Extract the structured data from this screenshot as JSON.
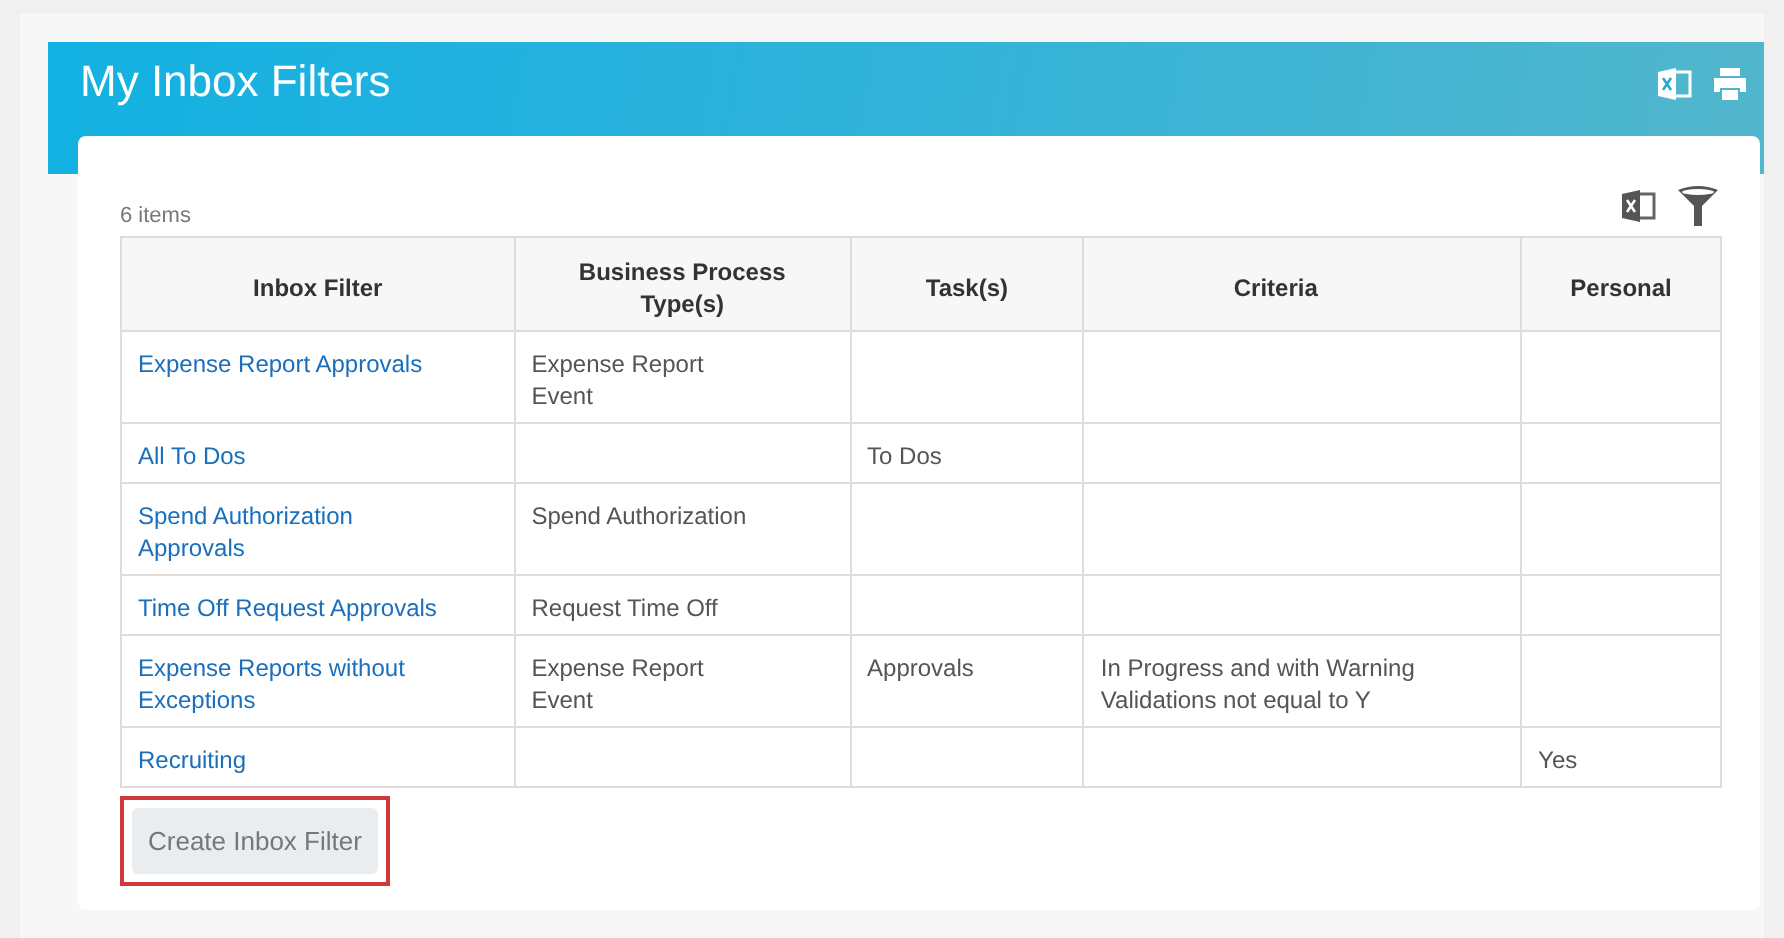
{
  "header": {
    "title": "My Inbox Filters"
  },
  "count": "6 items",
  "table": {
    "columns": [
      "Inbox Filter",
      "Business Process Type(s)",
      "Task(s)",
      "Criteria",
      "Personal"
    ],
    "rows": [
      {
        "name": "Expense Report Approvals",
        "process": "Expense Report Event",
        "tasks": "",
        "criteria": "",
        "personal": ""
      },
      {
        "name": "All To Dos",
        "process": "",
        "tasks": "To Dos",
        "criteria": "",
        "personal": ""
      },
      {
        "name": "Spend Authorization Approvals",
        "process": "Spend Authorization",
        "tasks": "",
        "criteria": "",
        "personal": ""
      },
      {
        "name": "Time Off Request Approvals",
        "process": "Request Time Off",
        "tasks": "",
        "criteria": "",
        "personal": ""
      },
      {
        "name": "Expense Reports without Exceptions",
        "process": "Expense Report Event",
        "tasks": "Approvals",
        "criteria": "In Progress and with Warning Validations not equal to Y",
        "personal": ""
      },
      {
        "name": "Recruiting",
        "process": "",
        "tasks": "",
        "criteria": "",
        "personal": "Yes"
      }
    ]
  },
  "button": {
    "label": "Create Inbox Filter",
    "highlighted": true
  }
}
